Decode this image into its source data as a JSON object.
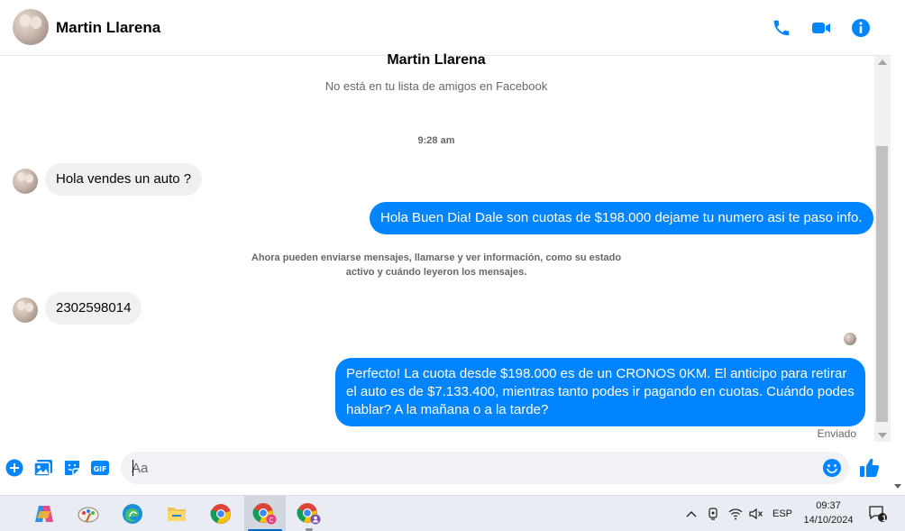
{
  "header": {
    "contact_name": "Martin Llarena",
    "icons": [
      "phone-icon",
      "video-camera-icon",
      "info-icon"
    ],
    "accent_color": "#0084ff"
  },
  "profile": {
    "name": "Martin Llarena",
    "subtitle": "No está en tu lista de amigos en Facebook"
  },
  "conversation": {
    "timestamp": "9:28 am",
    "messages": [
      {
        "from": "contact",
        "text": "Hola vendes un auto ?"
      },
      {
        "from": "me",
        "text": "Hola Buen Dia! Dale son cuotas de $198.000 dejame tu numero asi te paso info."
      },
      {
        "from": "contact",
        "text": "2302598014"
      },
      {
        "from": "me",
        "text": "Perfecto! La cuota desde $198.000 es de un CRONOS 0KM. El anticipo para retirar el auto es de $7.133.400, mientras tanto podes ir pagando en cuotas. Cuándo podes hablar? A la mañana o a la tarde?"
      }
    ],
    "notice": "Ahora pueden enviarse mensajes, llamarse y ver información, como su estado activo y cuándo leyeron los mensajes.",
    "last_status": "Enviado"
  },
  "composer": {
    "placeholder": "Aa",
    "value": "",
    "icons": [
      "plus-circle-icon",
      "photo-icon",
      "sticker-icon",
      "gif-icon",
      "emoji-icon",
      "thumbs-up-icon"
    ]
  },
  "taskbar": {
    "apps": [
      "copilot-icon",
      "paint-icon",
      "edge-icon",
      "file-explorer-icon",
      "chrome-icon",
      "chrome-profile-icon",
      "chrome-profile-2-icon"
    ],
    "language": "ESP",
    "time": "09:37",
    "date": "14/10/2024",
    "notification_count": "1"
  }
}
